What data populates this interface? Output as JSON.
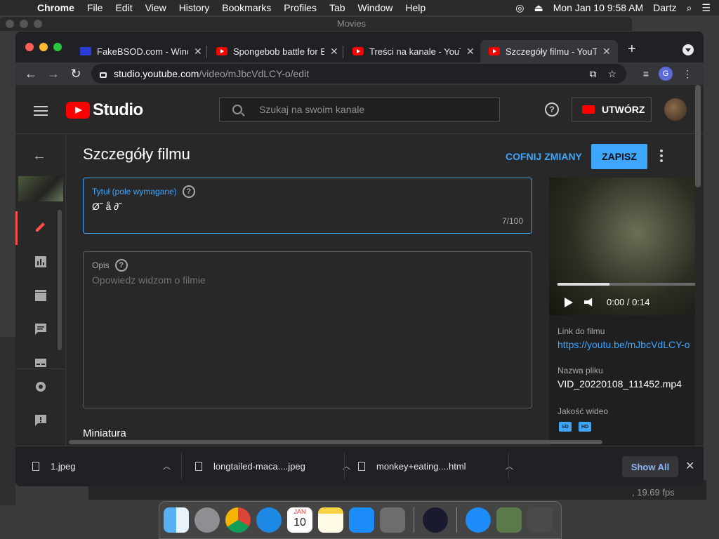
{
  "menubar": {
    "app": "Chrome",
    "items": [
      "File",
      "Edit",
      "View",
      "History",
      "Bookmarks",
      "Profiles",
      "Tab",
      "Window",
      "Help"
    ],
    "datetime": "Mon Jan 10  9:58 AM",
    "user": "Dartz"
  },
  "background_window": {
    "title": "Movies",
    "fps": ", 19.69 fps"
  },
  "tabs": [
    {
      "label": "FakeBSOD.com - Windows",
      "icon": "bsod-favicon"
    },
    {
      "label": "Spongebob battle for Bikini",
      "icon": "youtube-favicon"
    },
    {
      "label": "Treści na kanale - YouTube",
      "icon": "youtube-favicon"
    },
    {
      "label": "Szczegóły filmu - YouTube",
      "icon": "youtube-favicon",
      "active": true
    }
  ],
  "toolbar": {
    "url_host": "studio.youtube.com",
    "url_path": "/video/mJbcVdLCY-o/edit",
    "profile_initial": "G"
  },
  "header": {
    "logo_text": "Studio",
    "search_placeholder": "Szukaj na swoim kanale",
    "create_label": "UTWÓRZ"
  },
  "details": {
    "page_title": "Szczegóły filmu",
    "undo_label": "COFNIJ ZMIANY",
    "save_label": "ZAPISZ",
    "title_field": {
      "label": "Tytuł (pole wymagane)",
      "value": "Ø˜ å ∂ˆ",
      "count": "7/100"
    },
    "description_field": {
      "label": "Opis",
      "placeholder": "Opowiedz widzom o filmie"
    },
    "next_section": "Miniatura"
  },
  "video_card": {
    "time": "0:00 / 0:14",
    "progress": 0.38,
    "link_label": "Link do filmu",
    "link": "https://youtu.be/mJbcVdLCY-o",
    "filename_label": "Nazwa pliku",
    "filename": "VID_20220108_111452.mp4",
    "quality_label": "Jakość wideo",
    "quality_badges": [
      "SD",
      "HD"
    ]
  },
  "downloads": {
    "items": [
      "1.jpeg",
      "longtailed-maca....jpeg",
      "monkey+eating....html"
    ],
    "show_all": "Show All"
  },
  "dock": {
    "apps": [
      "finder-icon",
      "launchpad-icon",
      "chrome-icon",
      "safari-icon",
      "calendar-icon",
      "notes-icon",
      "app-store-icon",
      "system-preferences-icon",
      "obs-icon",
      "app-store-downloads-icon",
      "preview-icon",
      "trash-icon"
    ],
    "calendar_month": "JAN",
    "calendar_day": "10"
  }
}
